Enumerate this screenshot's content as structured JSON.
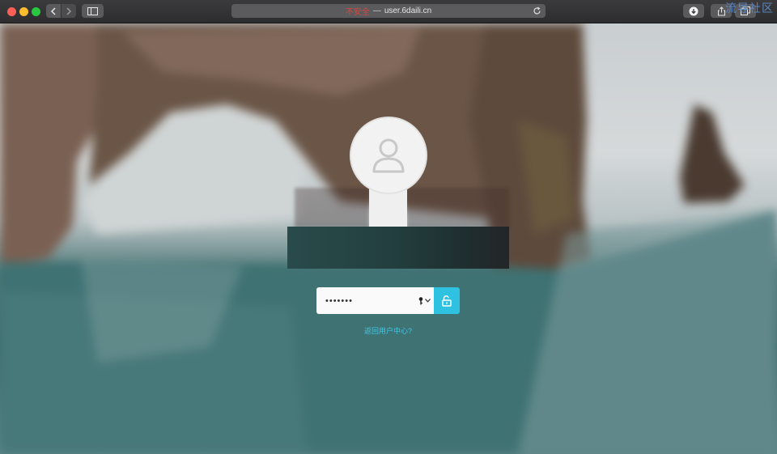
{
  "window": {
    "address": {
      "insecure_label": "不安全",
      "separator": "—",
      "domain": "user.6daili.cn"
    },
    "icons": {
      "back": "chevron-left-icon",
      "forward": "chevron-right-icon",
      "sidebar": "sidebar-icon",
      "reload": "reload-icon",
      "download": "download-icon",
      "share": "share-icon",
      "tabs": "tabs-icon"
    },
    "watermark": "流导社区"
  },
  "lock_screen": {
    "avatar_icon": "user-avatar-icon",
    "password": {
      "masked_value": "•••••••",
      "key_icon": "key-icon",
      "dropdown_icon": "chevron-down-icon"
    },
    "unlock_icon": "unlock-icon",
    "back_link": "返回用户中心?",
    "colors": {
      "accent": "#2ec2e0",
      "link": "#40c8e8"
    }
  }
}
